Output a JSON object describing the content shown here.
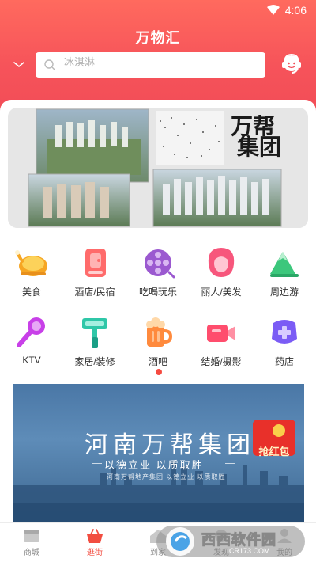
{
  "status_bar": {
    "time": "4:06"
  },
  "header": {
    "title": "万物汇"
  },
  "search": {
    "placeholder": "冰淇淋"
  },
  "banner": {
    "calligraphy_line1": "万帮",
    "calligraphy_line2": "集团"
  },
  "categories": [
    {
      "label": "美食",
      "icon": "roast-chicken-icon"
    },
    {
      "label": "酒店/民宿",
      "icon": "hotel-icon"
    },
    {
      "label": "吃喝玩乐",
      "icon": "film-reel-icon"
    },
    {
      "label": "丽人/美发",
      "icon": "woman-hair-icon"
    },
    {
      "label": "周边游",
      "icon": "mountain-icon"
    },
    {
      "label": "KTV",
      "icon": "microphone-icon"
    },
    {
      "label": "家居/装修",
      "icon": "paint-roller-icon"
    },
    {
      "label": "酒吧",
      "icon": "beer-mug-icon"
    },
    {
      "label": "结婚/摄影",
      "icon": "video-camera-icon"
    },
    {
      "label": "药店",
      "icon": "medicine-kit-icon"
    }
  ],
  "ad": {
    "title": "河南万帮集团",
    "slogan": "以德立业  以质取胜",
    "subtext": "河南万帮地产集团 以德立业 以质取胜",
    "red_packet_label": "抢红包"
  },
  "bottom_nav": [
    {
      "label": "商城",
      "icon": "store-icon"
    },
    {
      "label": "逛街",
      "icon": "shopping-basket-icon"
    },
    {
      "label": "到家",
      "icon": "home-icon"
    },
    {
      "label": "发现",
      "icon": "discover-icon"
    },
    {
      "label": "我的",
      "icon": "profile-icon"
    }
  ],
  "watermark": {
    "text": "西西软件园",
    "url": "CR173.COM"
  },
  "colors": {
    "accent": "#f24d57",
    "header_gradient_top": "#ff6a5e",
    "active_nav": "#f24d40"
  }
}
